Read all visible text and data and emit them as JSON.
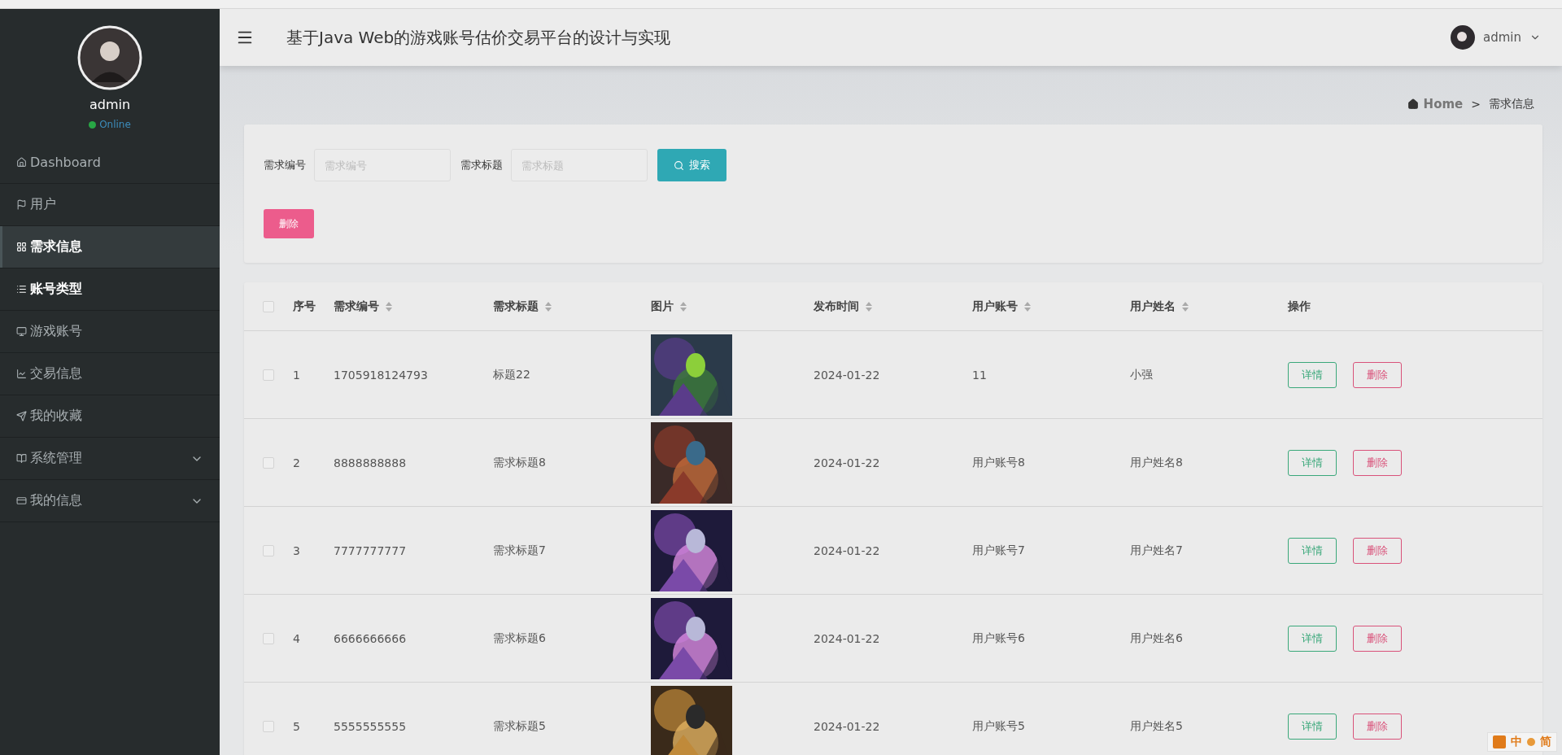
{
  "sidebar": {
    "user": {
      "name": "admin",
      "status": "Online"
    },
    "items": [
      {
        "label": "Dashboard",
        "selected": false,
        "hovered": false,
        "expandable": false
      },
      {
        "label": "用户",
        "selected": false,
        "hovered": false,
        "expandable": false
      },
      {
        "label": "需求信息",
        "selected": true,
        "hovered": false,
        "expandable": false
      },
      {
        "label": "账号类型",
        "selected": false,
        "hovered": true,
        "expandable": false
      },
      {
        "label": "游戏账号",
        "selected": false,
        "hovered": false,
        "expandable": false
      },
      {
        "label": "交易信息",
        "selected": false,
        "hovered": false,
        "expandable": false
      },
      {
        "label": "我的收藏",
        "selected": false,
        "hovered": false,
        "expandable": false
      },
      {
        "label": "系统管理",
        "selected": false,
        "hovered": false,
        "expandable": true
      },
      {
        "label": "我的信息",
        "selected": false,
        "hovered": false,
        "expandable": true
      }
    ]
  },
  "header": {
    "title": "基于Java Web的游戏账号估价交易平台的设计与实现",
    "user": "admin"
  },
  "breadcrumb": {
    "home": "Home",
    "separator": ">",
    "current": "需求信息"
  },
  "search": {
    "fields": [
      {
        "label": "需求编号",
        "placeholder": "需求编号"
      },
      {
        "label": "需求标题",
        "placeholder": "需求标题"
      }
    ],
    "search_button": "搜索",
    "delete_button": "删除"
  },
  "table": {
    "all_checked": false,
    "columns": [
      {
        "label": "序号",
        "sortable": false
      },
      {
        "label": "需求编号",
        "sortable": true
      },
      {
        "label": "需求标题",
        "sortable": true
      },
      {
        "label": "图片",
        "sortable": true
      },
      {
        "label": "发布时间",
        "sortable": true
      },
      {
        "label": "用户账号",
        "sortable": true
      },
      {
        "label": "用户姓名",
        "sortable": true
      },
      {
        "label": "操作",
        "sortable": false
      }
    ],
    "rows": [
      {
        "checked": false,
        "index": "1",
        "code": "1705918124793",
        "title": "标题22",
        "date": "2024-01-22",
        "account": "11",
        "name": "小强",
        "detail_button": "详情",
        "delete_button": "删除"
      },
      {
        "checked": false,
        "index": "2",
        "code": "8888888888",
        "title": "需求标题8",
        "date": "2024-01-22",
        "account": "用户账号8",
        "name": "用户姓名8",
        "detail_button": "详情",
        "delete_button": "删除"
      },
      {
        "checked": false,
        "index": "3",
        "code": "7777777777",
        "title": "需求标题7",
        "date": "2024-01-22",
        "account": "用户账号7",
        "name": "用户姓名7",
        "detail_button": "详情",
        "delete_button": "删除"
      },
      {
        "checked": false,
        "index": "4",
        "code": "6666666666",
        "title": "需求标题6",
        "date": "2024-01-22",
        "account": "用户账号6",
        "name": "用户姓名6",
        "detail_button": "详情",
        "delete_button": "删除"
      },
      {
        "checked": false,
        "index": "5",
        "code": "5555555555",
        "title": "需求标题5",
        "date": "2024-01-22",
        "account": "用户账号5",
        "name": "用户姓名5",
        "detail_button": "详情",
        "delete_button": "删除"
      }
    ]
  },
  "ime_bar": {
    "mode": "中",
    "script": "简"
  }
}
